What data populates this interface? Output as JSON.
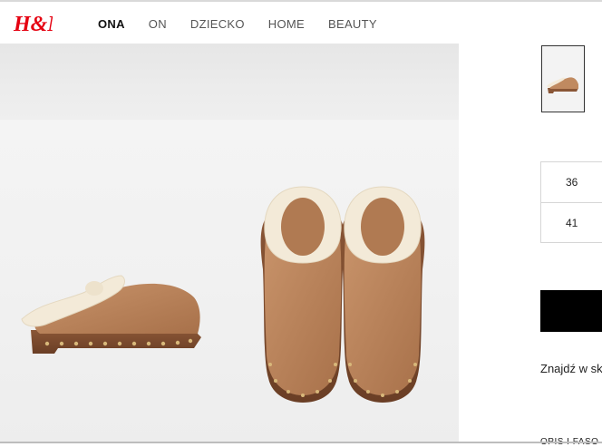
{
  "brand": {
    "logo_text": "H&M",
    "color": "#e50010"
  },
  "nav": {
    "items": [
      {
        "label": "ONA",
        "active": true
      },
      {
        "label": "ON",
        "active": false
      },
      {
        "label": "DZIECKO",
        "active": false
      },
      {
        "label": "HOME",
        "active": false
      },
      {
        "label": "BEAUTY",
        "active": false
      }
    ]
  },
  "product": {
    "sizes": [
      "36",
      "41"
    ],
    "find_in_store": "Znajdź w sk",
    "description_cut": "OPIS I FASO"
  },
  "colors": {
    "accent": "#000000",
    "suede": "#b98259",
    "shearling": "#f3ead8"
  }
}
